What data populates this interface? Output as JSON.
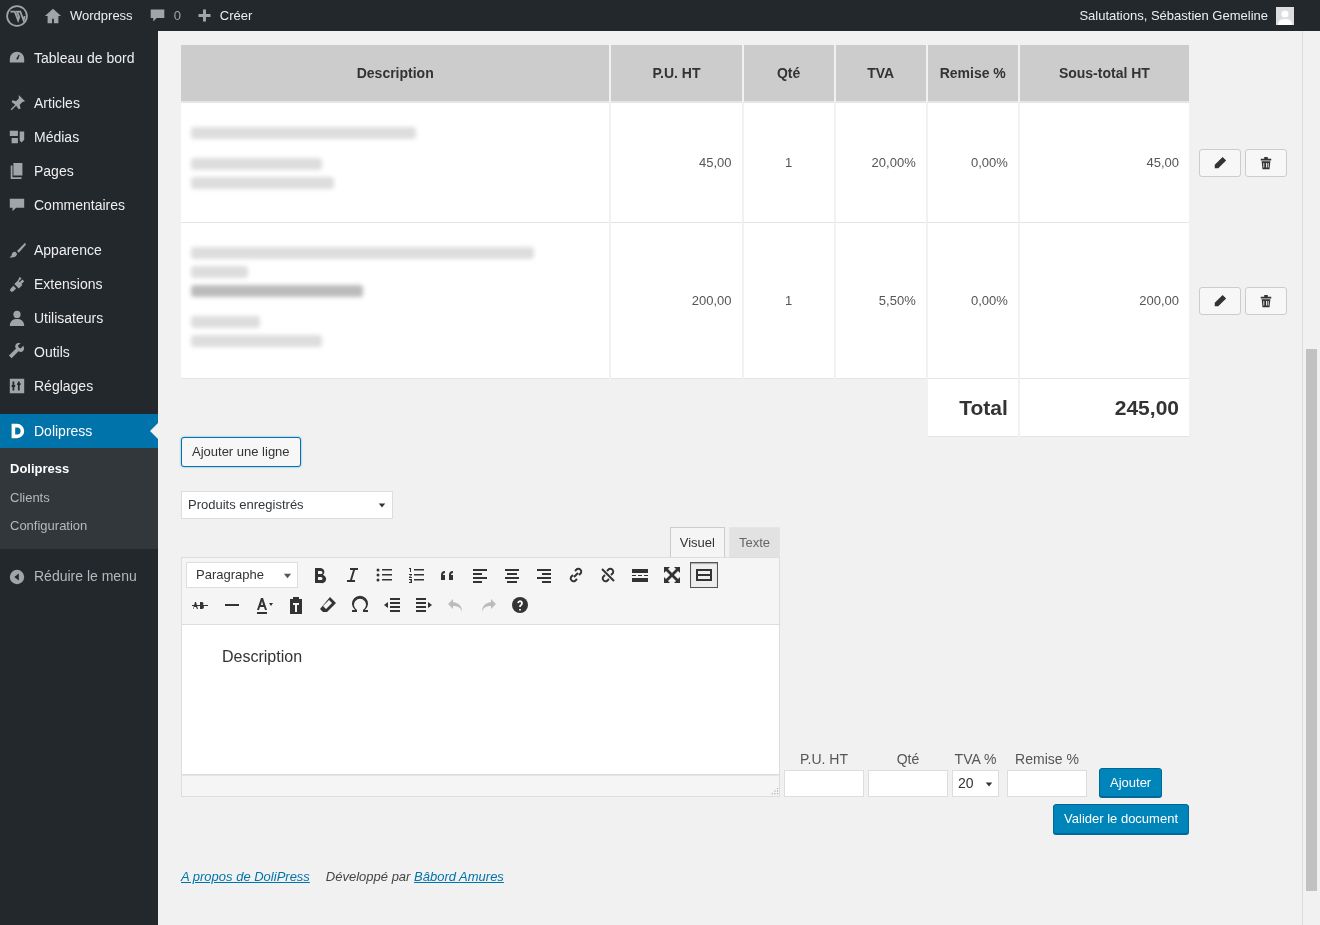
{
  "admin_bar": {
    "site": "Wordpress",
    "comments": "0",
    "new": "Créer",
    "greeting": "Salutations, Sébastien Gemeline"
  },
  "sidebar": {
    "groups": [
      [
        {
          "label": "Tableau de bord",
          "kind": "dashboard",
          "selected": false
        }
      ],
      [
        {
          "label": "Articles",
          "kind": "pin",
          "selected": false
        },
        {
          "label": "Médias",
          "kind": "media",
          "selected": false
        },
        {
          "label": "Pages",
          "kind": "pages",
          "selected": false
        },
        {
          "label": "Commentaires",
          "kind": "comment",
          "selected": false
        }
      ],
      [
        {
          "label": "Apparence",
          "kind": "brush",
          "selected": false
        },
        {
          "label": "Extensions",
          "kind": "plug",
          "selected": false
        },
        {
          "label": "Utilisateurs",
          "kind": "user",
          "selected": false
        },
        {
          "label": "Outils",
          "kind": "wrench",
          "selected": false
        },
        {
          "label": "Réglages",
          "kind": "sliders",
          "selected": false
        }
      ],
      [
        {
          "label": "Dolipress",
          "kind": "dolipress",
          "selected": true,
          "children": [
            {
              "label": "Dolipress",
              "selected": true
            },
            {
              "label": "Clients",
              "selected": false
            },
            {
              "label": "Configuration",
              "selected": false
            }
          ]
        }
      ]
    ],
    "collapse": "Réduire le menu"
  },
  "table": {
    "columns": [
      "Description",
      "P.U. HT",
      "Qté",
      "TVA",
      "Remise %",
      "Sous-total HT"
    ],
    "rows": [
      {
        "description_lines": [
          {
            "kind": "heading"
          },
          {
            "kind": "gap"
          },
          {
            "kind": "plain"
          },
          {
            "kind": "plain"
          }
        ],
        "unit_price": "45,00",
        "qty": "1",
        "vat": "20,00%",
        "discount": "0,00%",
        "subtotal": "45,00"
      },
      {
        "description_lines": [
          {
            "kind": "heading"
          },
          {
            "kind": "plain"
          },
          {
            "kind": "link"
          },
          {
            "kind": "gap"
          },
          {
            "kind": "plain"
          },
          {
            "kind": "plain"
          }
        ],
        "unit_price": "200,00",
        "qty": "1",
        "vat": "5,50%",
        "discount": "0,00%",
        "subtotal": "200,00"
      }
    ],
    "total_label": "Total",
    "total": "245,00"
  },
  "add_line_button": "Ajouter une ligne",
  "product_select": "Produits enregistrés",
  "editor": {
    "tabs": [
      {
        "label": "Visuel",
        "selected": true
      },
      {
        "label": "Texte",
        "selected": false
      }
    ],
    "format": "Paragraphe",
    "toolbar": [
      [
        {
          "kind": "bold",
          "active": false
        },
        {
          "kind": "italic",
          "active": false
        },
        {
          "kind": "bullets",
          "active": false
        },
        {
          "kind": "numbers",
          "active": false
        },
        {
          "kind": "quote",
          "active": false
        },
        {
          "kind": "alignleft",
          "active": false
        },
        {
          "kind": "aligncenter",
          "active": false
        },
        {
          "kind": "alignright",
          "active": false
        },
        {
          "kind": "link",
          "active": false
        },
        {
          "kind": "unlink",
          "active": false
        },
        {
          "kind": "more",
          "active": false
        },
        {
          "kind": "fullscreen",
          "active": false
        },
        {
          "kind": "toolbar",
          "active": true
        }
      ],
      [
        {
          "kind": "strike",
          "active": false
        },
        {
          "kind": "hr",
          "active": false
        },
        {
          "kind": "color",
          "active": false
        },
        {
          "kind": "paste",
          "active": false
        },
        {
          "kind": "eraser",
          "active": false
        },
        {
          "kind": "omega",
          "active": false
        },
        {
          "kind": "outdent",
          "active": false
        },
        {
          "kind": "indent",
          "active": false
        },
        {
          "kind": "undo",
          "active": false
        },
        {
          "kind": "redo",
          "active": false
        },
        {
          "kind": "help",
          "active": false
        }
      ]
    ],
    "content": "Description"
  },
  "line_form": {
    "labels": [
      "P.U. HT",
      "Qté",
      "TVA %",
      "Remise %"
    ],
    "vat": "20",
    "submit": "Ajouter"
  },
  "validate_button": "Valider le document",
  "footer": {
    "about": "A propos de DoliPress",
    "credit": "Développé par",
    "author": "Bâbord Amures"
  }
}
